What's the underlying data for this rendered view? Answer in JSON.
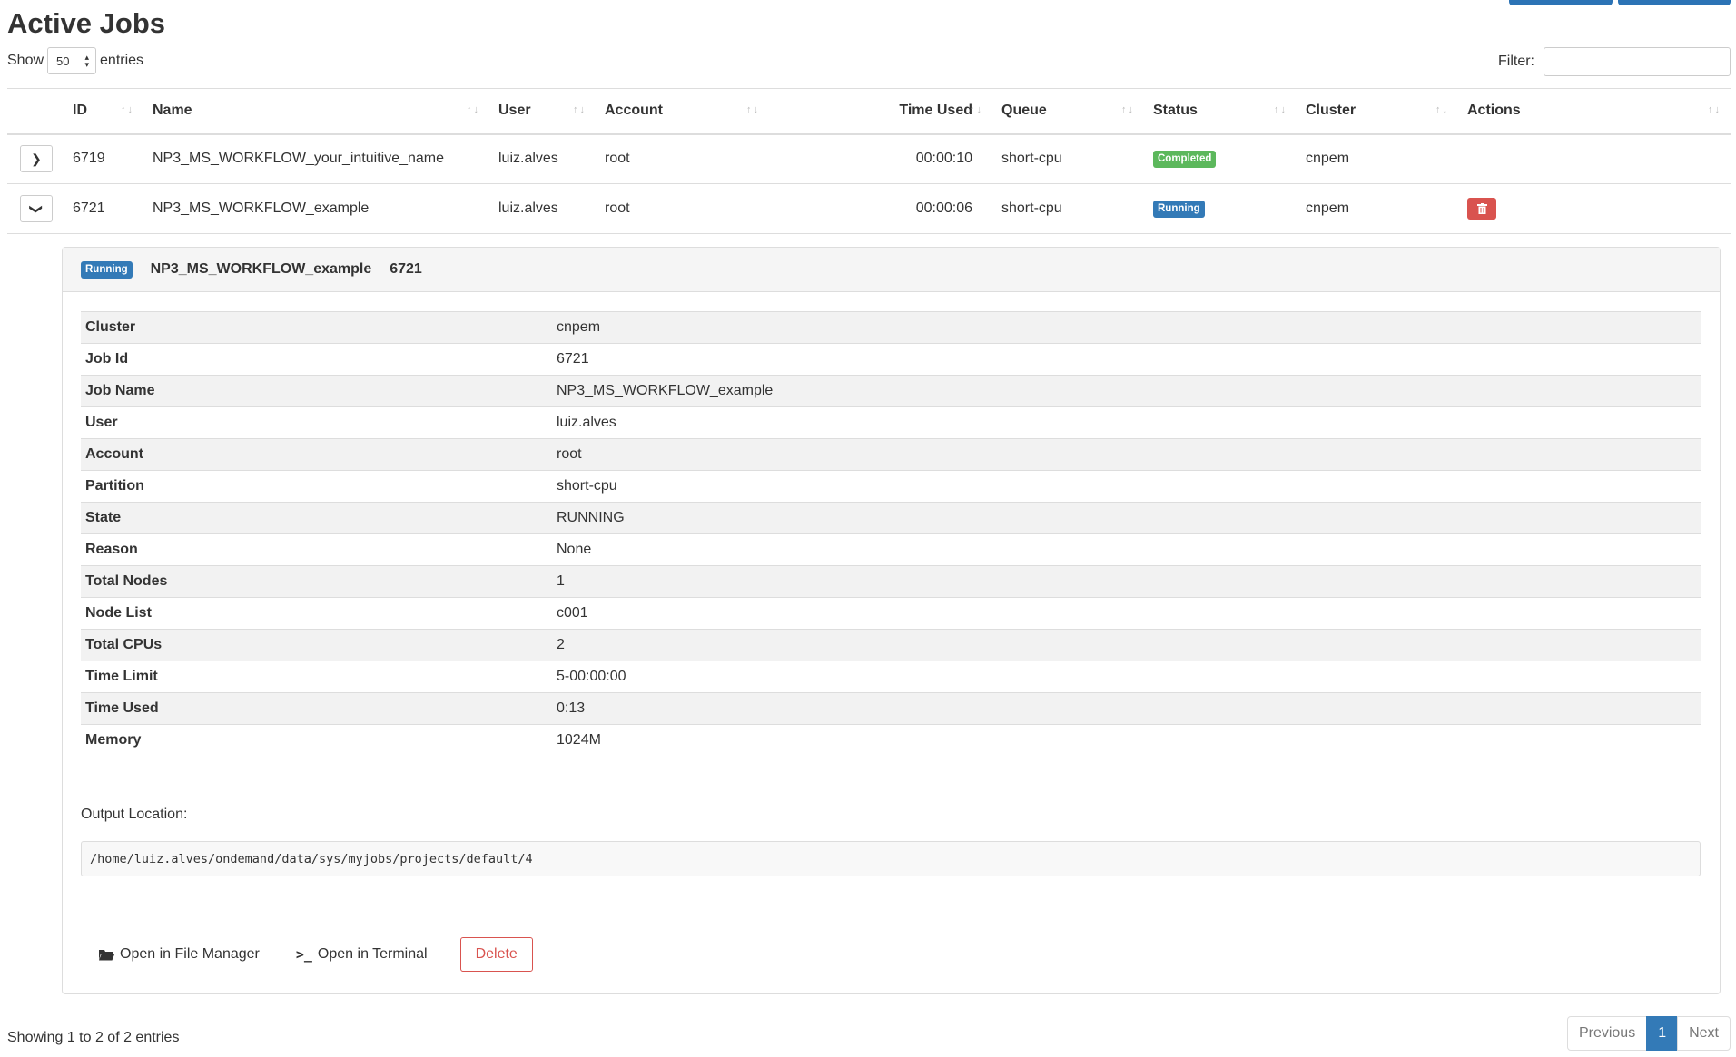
{
  "page": {
    "title": "Active Jobs",
    "show_label": "Show",
    "entries_label": "entries",
    "page_length": "50",
    "filter_label": "Filter:",
    "filter_value": ""
  },
  "columns": [
    "ID",
    "Name",
    "User",
    "Account",
    "Time Used",
    "Queue",
    "Status",
    "Cluster",
    "Actions"
  ],
  "jobs": [
    {
      "id": "6719",
      "name": "NP3_MS_WORKFLOW_your_intuitive_name",
      "user": "luiz.alves",
      "account": "root",
      "time_used": "00:00:10",
      "queue": "short-cpu",
      "status": "Completed",
      "cluster": "cnpem",
      "expanded": false
    },
    {
      "id": "6721",
      "name": "NP3_MS_WORKFLOW_example",
      "user": "luiz.alves",
      "account": "root",
      "time_used": "00:00:06",
      "queue": "short-cpu",
      "status": "Running",
      "cluster": "cnpem",
      "expanded": true
    }
  ],
  "detail": {
    "status": "Running",
    "name": "NP3_MS_WORKFLOW_example",
    "id": "6721",
    "properties": [
      {
        "key": "Cluster",
        "value": "cnpem"
      },
      {
        "key": "Job Id",
        "value": "6721"
      },
      {
        "key": "Job Name",
        "value": "NP3_MS_WORKFLOW_example"
      },
      {
        "key": "User",
        "value": "luiz.alves"
      },
      {
        "key": "Account",
        "value": "root"
      },
      {
        "key": "Partition",
        "value": "short-cpu"
      },
      {
        "key": "State",
        "value": "RUNNING"
      },
      {
        "key": "Reason",
        "value": "None"
      },
      {
        "key": "Total Nodes",
        "value": "1"
      },
      {
        "key": "Node List",
        "value": "c001"
      },
      {
        "key": "Total CPUs",
        "value": "2"
      },
      {
        "key": "Time Limit",
        "value": "5-00:00:00"
      },
      {
        "key": "Time Used",
        "value": "0:13"
      },
      {
        "key": "Memory",
        "value": "1024M"
      }
    ],
    "output_label": "Output Location:",
    "output_path": "/home/luiz.alves/ondemand/data/sys/myjobs/projects/default/4",
    "open_files_label": "Open in File Manager",
    "open_terminal_label": "Open in Terminal",
    "delete_label": "Delete"
  },
  "footer": {
    "info": "Showing 1 to 2 of 2 entries",
    "previous": "Previous",
    "current_page": "1",
    "next": "Next"
  },
  "colors": {
    "primary": "#337ab7",
    "success": "#5cb85c",
    "danger": "#d9534f"
  }
}
